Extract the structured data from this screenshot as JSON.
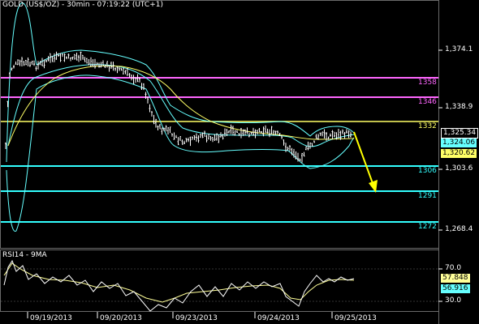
{
  "chart": {
    "title": "GOLD (US$/OZ) - 30min - 07:19:22 (UTC+1)",
    "price_axis": [
      "1,374.1",
      "1,338.9",
      "1,303.6",
      "1,268.4"
    ],
    "badges": {
      "last": "1,325.34",
      "mid": "1,324.06",
      "ma": "1,320.62"
    },
    "levels": [
      {
        "label": "1358",
        "color": "#ff66ff"
      },
      {
        "label": "1346",
        "color": "#ff66ff"
      },
      {
        "label": "1332",
        "color": "#ffff66"
      },
      {
        "label": "1306",
        "color": "#33ffff"
      },
      {
        "label": "1291",
        "color": "#33ffff"
      },
      {
        "label": "1272",
        "color": "#33ffff"
      }
    ]
  },
  "rsi": {
    "title": "RSI14 - 9MA",
    "axis": [
      "70.0",
      "30.0"
    ],
    "badges": {
      "rsi": "57.848",
      "ma": "56.916"
    }
  },
  "dates": [
    "09/19/2013",
    "09/20/2013",
    "09/23/2013",
    "09/24/2013",
    "09/25/2013"
  ],
  "colors": {
    "background": "#000000",
    "price_bars": "#ffffff",
    "bollinger": "#66ffff",
    "ma_yellow": "#ffff66",
    "arrow": "#ffff00",
    "rsi_line": "#ffffff",
    "rsi_ma": "#ffff99"
  }
}
